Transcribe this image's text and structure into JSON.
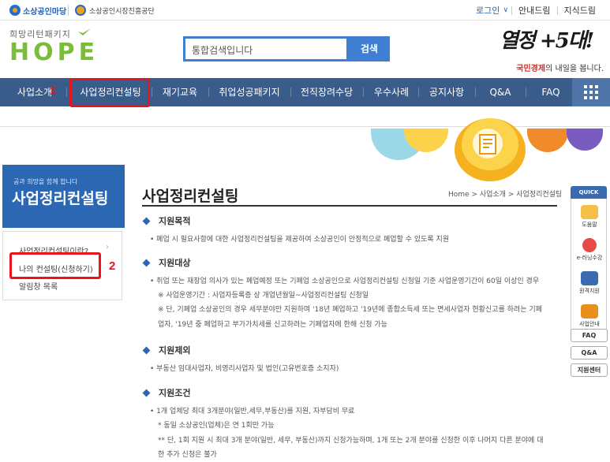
{
  "topbar": {
    "logo1": "소상공인마당",
    "logo2": "소상공인시장진흥공단",
    "links": [
      "로그인",
      "안내드림",
      "지식드림"
    ]
  },
  "header": {
    "hope_sub": "희망리턴패키지",
    "hope_word": "HOPE",
    "search_placeholder": "통합검색입니다",
    "search_button": "검색",
    "brand_script": "열정 +5대!",
    "brand_tag_red": "국민경제",
    "brand_tag_rest": "의 내일을 봅니다."
  },
  "nav": {
    "items": [
      "사업소개",
      "사업정리컨설팅",
      "재기교육",
      "취업성공패키지",
      "전직장려수당",
      "우수사례",
      "공지사항",
      "Q&A",
      "FAQ"
    ]
  },
  "annotations": {
    "one": "1",
    "two": "2"
  },
  "sidebar": {
    "banner_small": "공과 희망을 함께 합니다",
    "banner_title": "사업정리컨설팅",
    "items": [
      "사업정리컨설팅이란?",
      "나의 컨설팅(신청하기)",
      "알림창 목록"
    ]
  },
  "content": {
    "title": "사업정리컨설팅",
    "breadcrumb": "Home > 사업소개 > 사업정리컨설팅",
    "sections": [
      {
        "heading": "지원목적",
        "lines": [
          "• 폐업 시 필요사항에 대한 사업정리컨설팅을 제공하여 소상공인이 안정적으로 폐업할 수 있도록 지원"
        ]
      },
      {
        "heading": "지원대상",
        "lines": [
          "• 취업 또는 재창업 의사가 있는 폐업예정 또는 기폐업 소상공인으로 사업정리컨설팅 신청일 기준 사업운영기간이 60일 이상인 경우",
          "※ 사업운영기간 : 사업자등록증 상 개업년월일~사업정리컨설팅 신청일",
          "※ 단, 기폐업 소상공인의 경우 세무분야만 지원하며 '18년 폐업하고 '19년에 종합소득세 또는 면세사업자 현황신고를 하려는 기폐",
          "업자, '19년 중 폐업하고 부가가치세를 신고하려는 기폐업자에 한해 신청 가능"
        ]
      },
      {
        "heading": "지원제외",
        "lines": [
          "• 부동산 임대사업자, 비영리사업자 및 법인(고유번호증 소지자)"
        ]
      },
      {
        "heading": "지원조건",
        "lines": [
          "• 1개 업체당 최대 3개분야(일반,세무,부동산)를 지원, 자부담비 무료",
          "* 동일 소상공인(업체)은 연 1회만 가능",
          "** 단, 1회 지원 시 최대 3개 분야(일반, 세무, 부동산)까지 신청가능하며, 1개 또는 2개 분야를 신청한 이후 나머지 다른 분야에 대",
          "한 추가 신청은 불가"
        ]
      }
    ]
  },
  "quick": {
    "head": "QUICK",
    "items": [
      "도움말",
      "e-러닝수강",
      "원격지원",
      "사업안내"
    ],
    "buttons": [
      "FAQ",
      "Q&A",
      "지원센터"
    ]
  },
  "colors": {
    "nav": "#3a5c8a",
    "accent": "#2b67b2",
    "annotation": "#e8141c",
    "hope_green": "#7bbd38"
  }
}
